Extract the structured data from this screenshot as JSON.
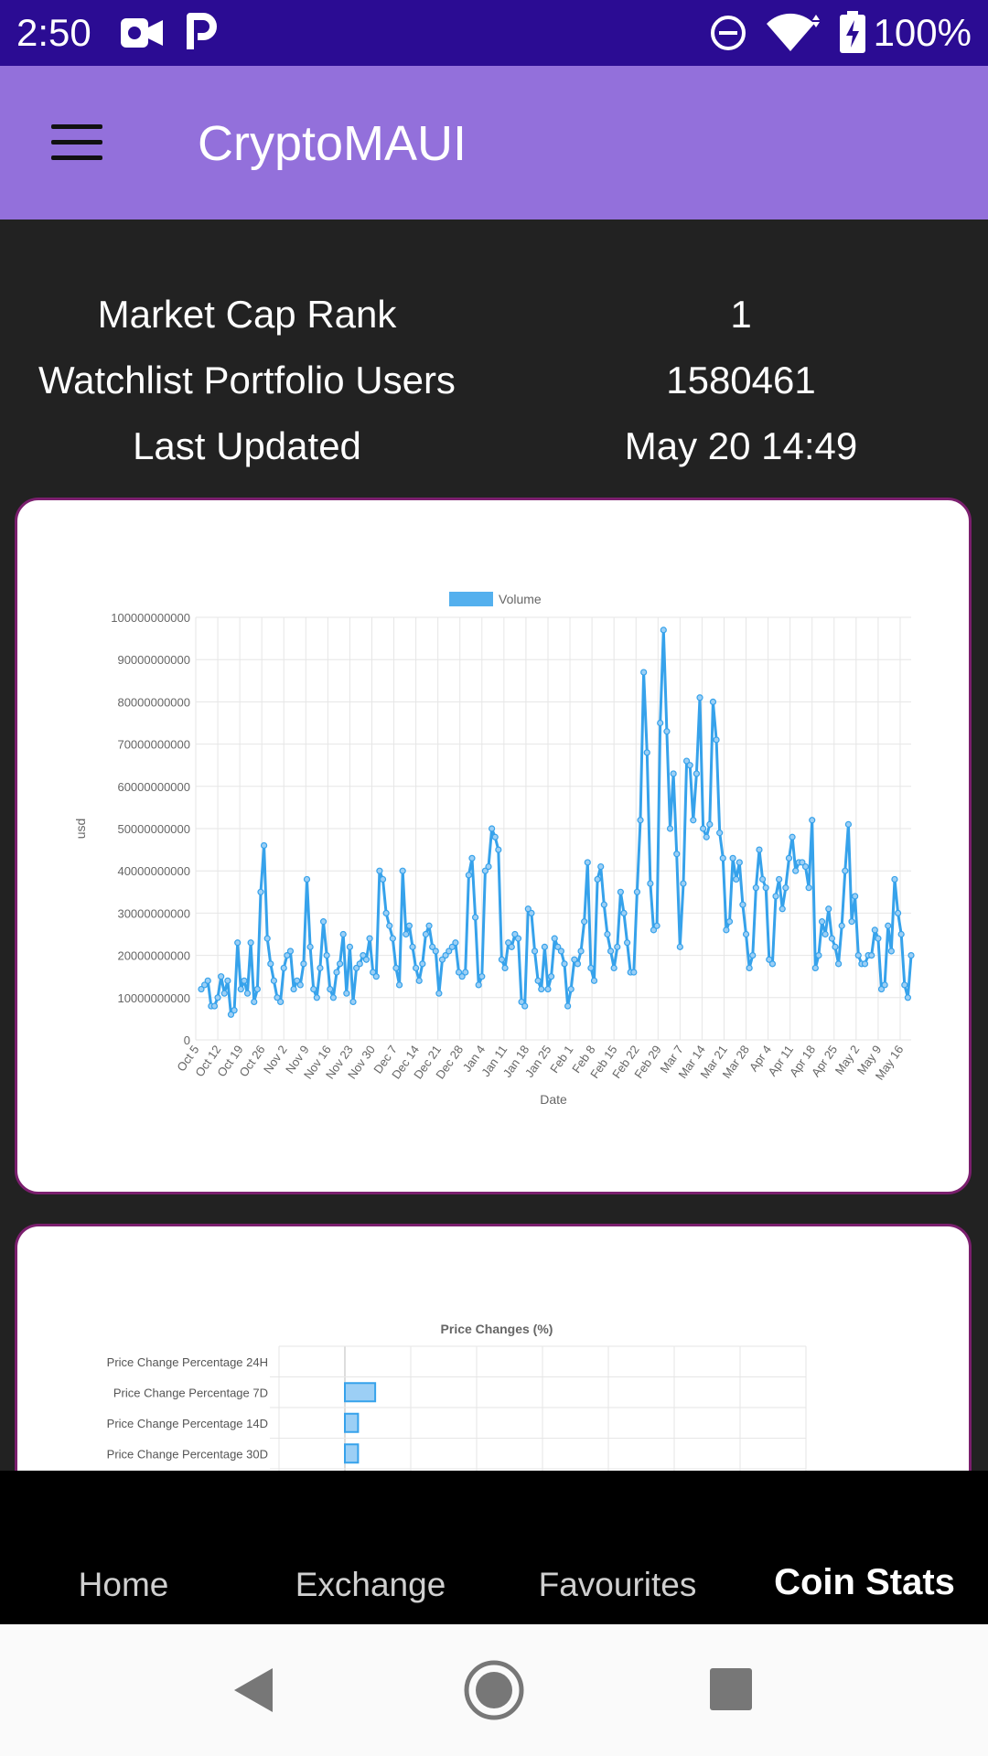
{
  "status_bar": {
    "time": "2:50",
    "battery": "100%"
  },
  "app": {
    "title": "CryptoMAUI",
    "menu_icon": "hamburger-icon"
  },
  "stats": [
    {
      "label": "Market Cap Rank",
      "value": "1"
    },
    {
      "label": "Watchlist Portfolio Users",
      "value": "1580461"
    },
    {
      "label": "Last Updated",
      "value": "May 20 14:49"
    }
  ],
  "chart_data": [
    {
      "type": "line",
      "legend": [
        "Volume"
      ],
      "legend_position": "top",
      "xlabel": "Date",
      "ylabel": "usd",
      "ylim": [
        0,
        100000000000
      ],
      "y_ticks": [
        "0",
        "10000000000",
        "20000000000",
        "30000000000",
        "40000000000",
        "50000000000",
        "60000000000",
        "70000000000",
        "80000000000",
        "90000000000",
        "100000000000"
      ],
      "x_ticks": [
        "Oct 5",
        "Oct 12",
        "Oct 19",
        "Oct 26",
        "Nov 2",
        "Nov 9",
        "Nov 16",
        "Nov 23",
        "Nov 30",
        "Dec 7",
        "Dec 14",
        "Dec 21",
        "Dec 28",
        "Jan 4",
        "Jan 11",
        "Jan 18",
        "Jan 25",
        "Feb 1",
        "Feb 8",
        "Feb 15",
        "Feb 22",
        "Feb 29",
        "Mar 7",
        "Mar 14",
        "Mar 21",
        "Mar 28",
        "Apr 4",
        "Apr 11",
        "Apr 18",
        "Apr 25",
        "May 2",
        "May 9",
        "May 16"
      ],
      "grid": true,
      "color": "#36a2eb",
      "series": [
        {
          "name": "Volume",
          "values": [
            12,
            13,
            14,
            8,
            8,
            10,
            15,
            11,
            14,
            6,
            7,
            23,
            12,
            14,
            11,
            23,
            9,
            12,
            35,
            46,
            24,
            18,
            14,
            10,
            9,
            17,
            20,
            21,
            12,
            14,
            13,
            18,
            38,
            22,
            12,
            10,
            17,
            28,
            20,
            12,
            10,
            16,
            18,
            25,
            11,
            22,
            9,
            17,
            18,
            20,
            19,
            24,
            16,
            15,
            40,
            38,
            30,
            27,
            24,
            17,
            13,
            40,
            25,
            27,
            22,
            17,
            14,
            18,
            25,
            27,
            22,
            21,
            11,
            19,
            20,
            21,
            22,
            23,
            16,
            15,
            16,
            39,
            43,
            29,
            13,
            15,
            40,
            41,
            50,
            48,
            45,
            19,
            17,
            23,
            22,
            25,
            24,
            9,
            8,
            31,
            30,
            21,
            14,
            12,
            22,
            12,
            15,
            24,
            22,
            21,
            18,
            8,
            12,
            19,
            18,
            21,
            28,
            42,
            17,
            14,
            38,
            41,
            32,
            25,
            21,
            17,
            22,
            35,
            30,
            23,
            16,
            16,
            35,
            52,
            87,
            68,
            37,
            26,
            27,
            75,
            97,
            73,
            50,
            63,
            44,
            22,
            37,
            66,
            65,
            52,
            63,
            81,
            50,
            48,
            51,
            80,
            71,
            49,
            43,
            26,
            28,
            43,
            38,
            42,
            32,
            25,
            17,
            20,
            36,
            45,
            38,
            36,
            19,
            18,
            34,
            38,
            31,
            36,
            43,
            48,
            40,
            42,
            42,
            41,
            36,
            52,
            17,
            20,
            28,
            25,
            31,
            24,
            22,
            18,
            27,
            40,
            51,
            28,
            34,
            20,
            18,
            18,
            20,
            20,
            26,
            24,
            12,
            13,
            27,
            21,
            38,
            30,
            25,
            13,
            10,
            20
          ]
        }
      ]
    },
    {
      "type": "bar",
      "orientation": "horizontal",
      "title": "Price Changes (%)",
      "categories": [
        "Price Change Percentage 24H",
        "Price Change Percentage 7D",
        "Price Change Percentage 14D",
        "Price Change Percentage 30D"
      ],
      "values": [
        0,
        2.3,
        1.0,
        1.0
      ],
      "xlim": [
        -5,
        35
      ],
      "grid": true,
      "color": "#36a2eb"
    }
  ],
  "tabs": [
    {
      "label": "Home",
      "active": false
    },
    {
      "label": "Exchange",
      "active": false
    },
    {
      "label": "Favourites",
      "active": false
    },
    {
      "label": "Coin Stats",
      "active": true
    }
  ],
  "nav": {
    "back": "back-icon",
    "home": "home-icon",
    "recents": "recents-icon"
  }
}
